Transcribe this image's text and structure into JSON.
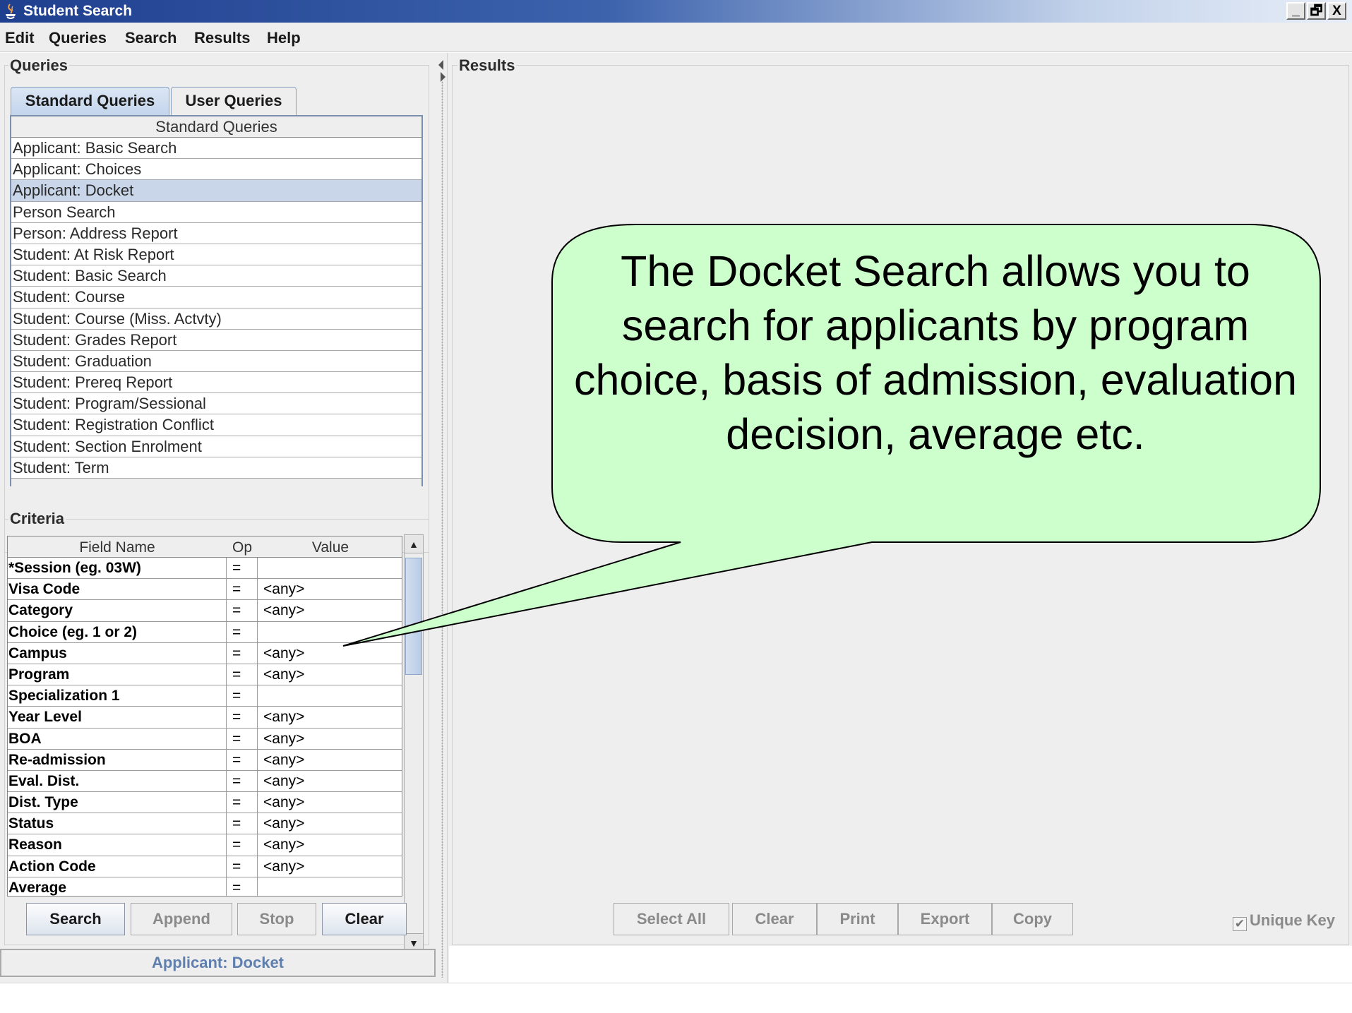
{
  "window": {
    "title": "Student Search",
    "buttons": [
      "_",
      "🗗",
      "X"
    ]
  },
  "menu": [
    "Edit",
    "Queries",
    "Search",
    "Results",
    "Help"
  ],
  "queries_panel": {
    "title": "Queries",
    "tabs": [
      "Standard Queries",
      "User Queries"
    ],
    "table_header": "Standard Queries",
    "items": [
      "Applicant: Basic Search",
      "Applicant: Choices",
      "Applicant: Docket",
      "Person Search",
      "Person: Address Report",
      "Student: At Risk Report",
      "Student: Basic Search",
      "Student: Course",
      "Student: Course (Miss. Actvty)",
      "Student: Grades Report",
      "Student: Graduation",
      "Student: Prereq Report",
      "Student: Program/Sessional",
      "Student: Registration Conflict",
      "Student: Section Enrolment",
      "Student: Term"
    ],
    "selected_index": 2
  },
  "criteria": {
    "title": "Criteria",
    "headers": [
      "Field Name",
      "Op",
      "Value"
    ],
    "rows": [
      {
        "name": "*Session (eg. 03W)",
        "op": "=",
        "value": ""
      },
      {
        "name": "Visa Code",
        "op": "=",
        "value": "<any>"
      },
      {
        "name": "Category",
        "op": "=",
        "value": "<any>"
      },
      {
        "name": "Choice (eg. 1 or 2)",
        "op": "=",
        "value": ""
      },
      {
        "name": "Campus",
        "op": "=",
        "value": "<any>"
      },
      {
        "name": "Program",
        "op": "=",
        "value": "<any>"
      },
      {
        "name": "Specialization 1",
        "op": "=",
        "value": ""
      },
      {
        "name": "Year Level",
        "op": "=",
        "value": "<any>"
      },
      {
        "name": "BOA",
        "op": "=",
        "value": "<any>"
      },
      {
        "name": "Re-admission",
        "op": "=",
        "value": "<any>"
      },
      {
        "name": "Eval. Dist.",
        "op": "=",
        "value": "<any>"
      },
      {
        "name": "Dist. Type",
        "op": "=",
        "value": "<any>"
      },
      {
        "name": "Status",
        "op": "=",
        "value": "<any>"
      },
      {
        "name": "Reason",
        "op": "=",
        "value": "<any>"
      },
      {
        "name": "Action Code",
        "op": "=",
        "value": "<any>"
      },
      {
        "name": "Average",
        "op": "=",
        "value": ""
      }
    ]
  },
  "left_buttons": [
    "Search",
    "Append",
    "Stop",
    "Clear"
  ],
  "status": "Applicant: Docket",
  "results_panel": {
    "title": "Results",
    "buttons": [
      "Select All",
      "Clear",
      "Print",
      "Export",
      "Copy"
    ],
    "unique_key_label": "Unique Key",
    "unique_key_checked": true
  },
  "callout": {
    "text": "The Docket Search allows you to search for applicants by program choice, basis of admission, evaluation decision, average etc.",
    "fill_color": "#ccffcc"
  }
}
